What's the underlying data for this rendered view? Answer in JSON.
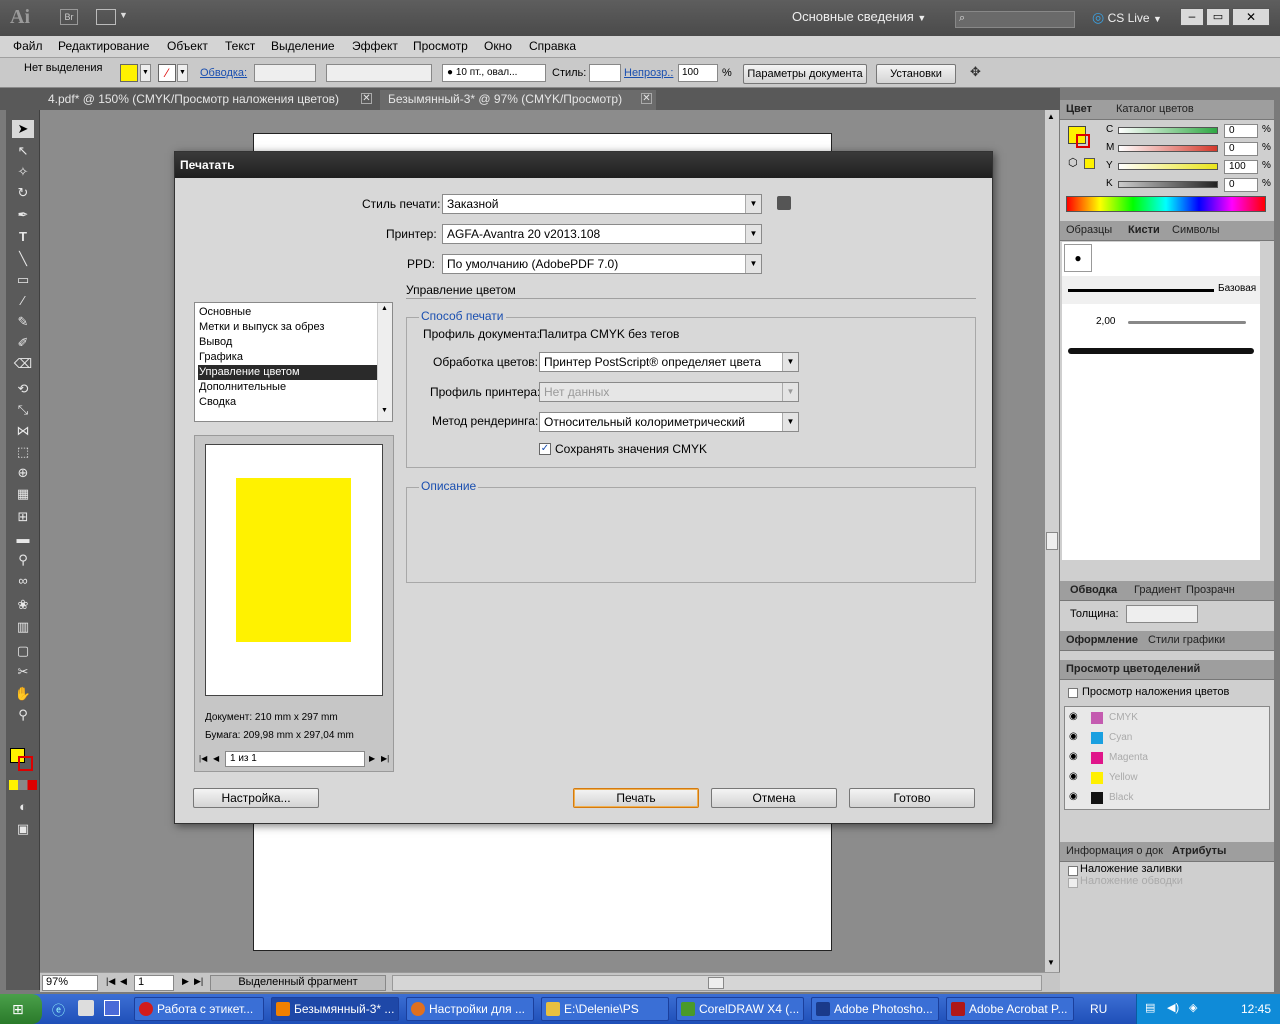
{
  "app": {
    "logo": "Ai",
    "bridge_btn": "Br",
    "workspace": "Основные сведения",
    "cslive": "CS Live"
  },
  "menu": [
    "Файл",
    "Редактирование",
    "Объект",
    "Текст",
    "Выделение",
    "Эффект",
    "Просмотр",
    "Окно",
    "Справка"
  ],
  "control_bar": {
    "selection": "Нет выделения",
    "stroke_label": "Обводка:",
    "brush": "10 пт., овал...",
    "style_label": "Стиль:",
    "opacity_label": "Непрозр.:",
    "opacity_value": "100",
    "percent": "%",
    "doc_params": "Параметры документа",
    "settings": "Установки"
  },
  "tabs": [
    {
      "label": "4.pdf* @ 150% (CMYK/Просмотр наложения цветов)"
    },
    {
      "label": "Безымянный-3* @ 97% (CMYK/Просмотр)"
    }
  ],
  "status": {
    "zoom": "97%",
    "page": "1",
    "fragment": "Выделенный фрагмент"
  },
  "panels": {
    "color_tab": "Цвет",
    "color_catalog_tab": "Каталог цветов",
    "cmyk": [
      {
        "ch": "C",
        "value": "0",
        "color": "#2fa843"
      },
      {
        "ch": "M",
        "value": "0",
        "color": "#d4382a"
      },
      {
        "ch": "Y",
        "value": "100",
        "color": "#e9e41a"
      },
      {
        "ch": "K",
        "value": "0",
        "color": "#222222"
      }
    ],
    "pct": "%",
    "swatches_tab": "Образцы",
    "brushes_tab": "Кисти",
    "symbols_tab": "Символы",
    "brush_basic": "Базовая",
    "brush_size": "2,00",
    "stroke_tab": "Обводка",
    "gradient_tab": "Градиент",
    "transparency_tab": "Прозрачн",
    "thickness_label": "Толщина:",
    "appearance_tab": "Оформление",
    "graphic_styles_tab": "Стили графики",
    "separations_tab": "Просмотр цветоделений",
    "overprint_label": "Просмотр наложения цветов",
    "plates": [
      {
        "name": "CMYK",
        "color": "#c45bb0"
      },
      {
        "name": "Cyan",
        "color": "#1aa0e0"
      },
      {
        "name": "Magenta",
        "color": "#e0158a"
      },
      {
        "name": "Yellow",
        "color": "#fff000"
      },
      {
        "name": "Black",
        "color": "#111111"
      }
    ],
    "info_tab": "Информация о док",
    "attributes_tab": "Атрибуты",
    "overprint_fill": "Наложение заливки",
    "overprint_stroke": "Наложение обводки"
  },
  "dialog": {
    "title": "Печатать",
    "print_style_label": "Стиль печати:",
    "print_style_value": "Заказной",
    "printer_label": "Принтер:",
    "printer_value": "AGFA-Avantra 20 v2013.108",
    "ppd_label": "PPD:",
    "ppd_value": "По умолчанию (AdobePDF 7.0)",
    "categories": [
      "Основные",
      "Метки и выпуск за обрез",
      "Вывод",
      "Графика",
      "Управление цветом",
      "Дополнительные",
      "Сводка"
    ],
    "selected_category_index": 4,
    "section_title": "Управление цветом",
    "print_method_group": "Способ печати",
    "doc_profile_label": "Профиль документа:",
    "doc_profile_value": "Палитра CMYK без тегов",
    "color_handling_label": "Обработка цветов:",
    "color_handling_value": "Принтер PostScript® определяет цвета",
    "printer_profile_label": "Профиль принтера:",
    "printer_profile_value": "Нет данных",
    "rendering_label": "Метод рендеринга:",
    "rendering_value": "Относительный колориметрический",
    "preserve_cmyk": "Сохранять значения CMYK",
    "preserve_cmyk_checked": true,
    "description_group": "Описание",
    "doc_size": "Документ: 210 mm x 297 mm",
    "paper_size": "Бумага: 209,98 mm x 297,04 mm",
    "page_nav": "1 из 1",
    "setup_btn": "Настройка...",
    "print_btn": "Печать",
    "cancel_btn": "Отмена",
    "done_btn": "Готово"
  },
  "taskbar": {
    "start": "",
    "items": [
      {
        "label": "Работа с этикет...",
        "color": "#d21c1c"
      },
      {
        "label": "Безымянный-3* ...",
        "color": "#f08000"
      },
      {
        "label": "Настройки для ...",
        "color": "#e07020"
      },
      {
        "label": "E:\\Delenie\\PS",
        "color": "#e8c040"
      },
      {
        "label": "CorelDRAW X4 (...",
        "color": "#4a9a2a"
      },
      {
        "label": "Adobe Photosho...",
        "color": "#1a3a8a"
      },
      {
        "label": "Adobe Acrobat P...",
        "color": "#b01818"
      }
    ],
    "lang": "RU",
    "time": "12:45"
  }
}
